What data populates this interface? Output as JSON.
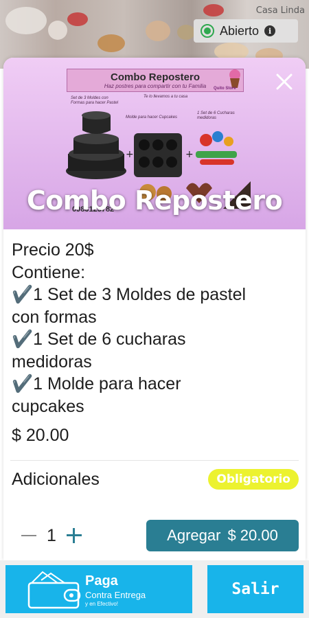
{
  "store": {
    "name": "Casa Linda",
    "status": "Abierto",
    "status_color": "#2fa84f"
  },
  "product": {
    "title": "Combo Repostero",
    "promo_banner_title": "Combo Repostero",
    "promo_banner_subtitle": "Haz postres para compartir con tu Familia",
    "promo_notes": [
      "Set de 3 Moldes con Formas para hacer Pastel",
      "Te lo llevamos a tu casa",
      "Molde para hacer Cupcakes",
      "1 Set de 6 Cucharas medidoras"
    ],
    "promo_logo": "Quito Store",
    "promo_phone": "0983125782",
    "description": [
      "Precio 20$",
      "Contiene:",
      "✔️1 Set de 3 Moldes de pastel",
      "con formas",
      "✔️1 Set de 6 cucharas",
      "medidoras",
      "✔️1 Molde para hacer",
      "cupcakes"
    ],
    "price": "$ 20.00"
  },
  "additionals": {
    "label": "Adicionales",
    "badge": "Obligatorio",
    "badge_color": "#ecf22f"
  },
  "cart": {
    "quantity": "1",
    "add_label": "Agregar",
    "add_price": "$ 20.00",
    "accent_color": "#2a7e93"
  },
  "footer": {
    "pay_title": "Paga",
    "pay_subtitle": "Contra Entrega",
    "pay_subtitle2": "y en Efectivo!",
    "exit_label": "Salir",
    "button_color": "#18b4ea"
  },
  "icons": [
    "close-icon",
    "info-icon",
    "status-dot-icon",
    "minus-icon",
    "plus-icon",
    "wallet-icon"
  ]
}
